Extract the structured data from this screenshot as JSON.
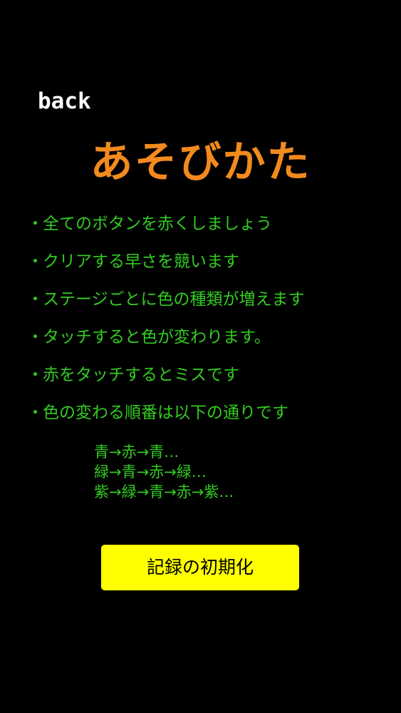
{
  "nav": {
    "back_label": "back"
  },
  "title": "あそびかた",
  "rules": [
    "全てのボタンを赤くしましょう",
    "クリアする早さを競います",
    "ステージごとに色の種類が増えます",
    "タッチすると色が変わります。",
    "赤をタッチするとミスです",
    "色の変わる順番は以下の通りです"
  ],
  "bullet": "・",
  "color_cycles": [
    "青→赤→青…",
    "緑→青→赤→緑…",
    "紫→緑→青→赤→紫…"
  ],
  "reset_button_label": "記録の初期化",
  "colors": {
    "background": "#000000",
    "title": "#f28a1e",
    "text": "#33cc22",
    "back": "#ffffff",
    "button": "#ffff00"
  }
}
